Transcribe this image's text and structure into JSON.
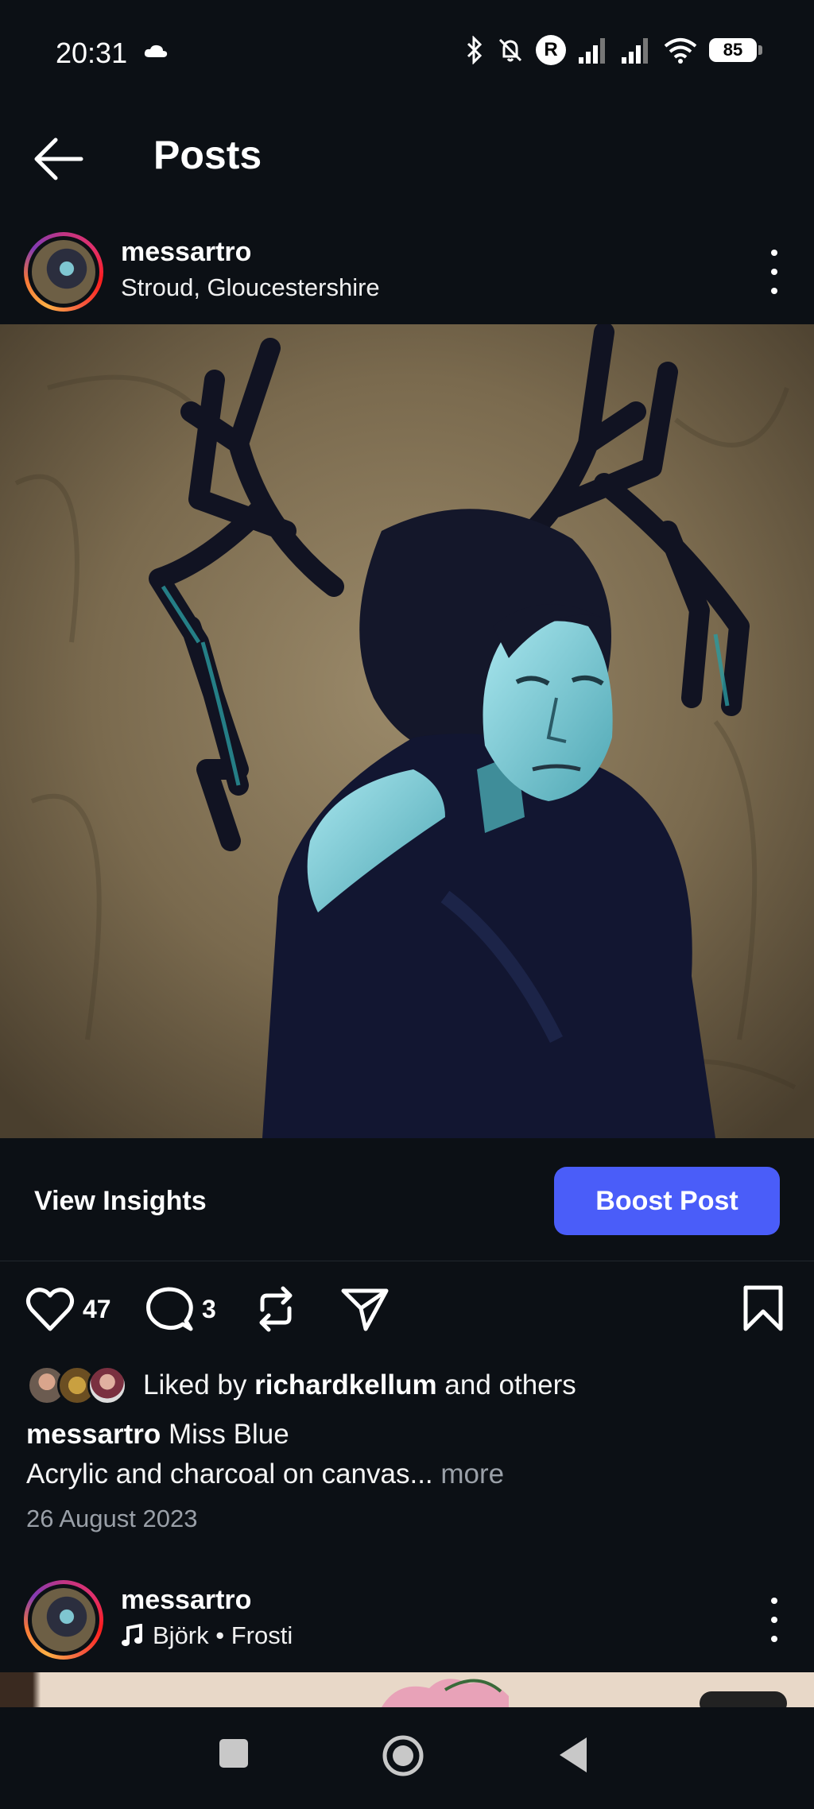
{
  "status_bar": {
    "time": "20:31",
    "battery": "85",
    "carrier_badge": "R",
    "icons": [
      "cloud-icon",
      "bluetooth-icon",
      "bell-off-icon",
      "signal-icon",
      "signal-icon",
      "wifi-icon",
      "battery-icon"
    ]
  },
  "header": {
    "title": "Posts",
    "back_icon": "arrow-left-icon"
  },
  "post": {
    "username": "messartro",
    "location": "Stroud, Gloucestershire",
    "view_insights_label": "View Insights",
    "boost_label": "Boost Post",
    "likes_count": "47",
    "comments_count": "3",
    "liked_by_prefix": "Liked by",
    "liked_by_user": "richardkellum",
    "liked_by_suffix": "and others",
    "caption_user": "messartro",
    "caption_title": "Miss Blue",
    "caption_body": "Acrylic and charcoal on canvas...",
    "more_label": "more",
    "date": "26 August 2023"
  },
  "next_post": {
    "username": "messartro",
    "music": "Björk • Frosti"
  },
  "colors": {
    "background": "#0c1015",
    "boost_button": "#4a5df9",
    "muted_text": "#9aa0a8"
  }
}
